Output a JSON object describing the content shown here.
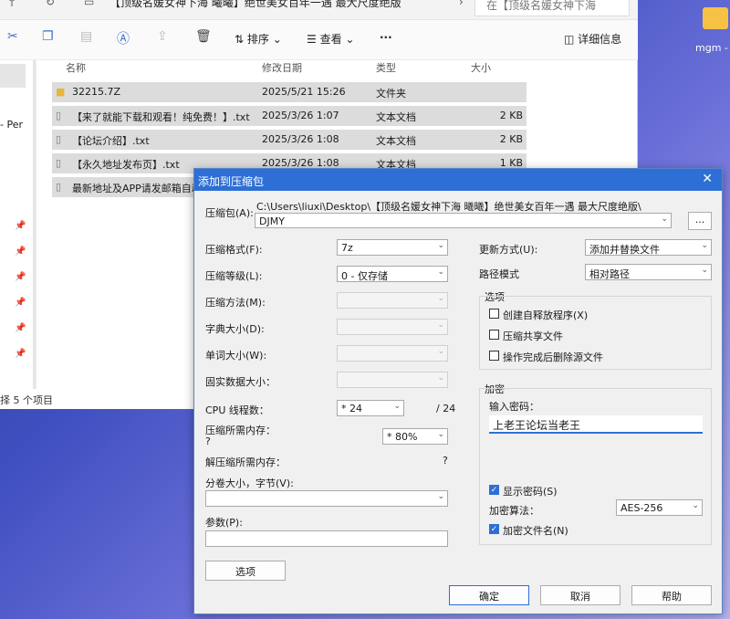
{
  "explorer": {
    "title_address": "【顶级名媛女神下海 曦曦】绝世美女百年一遇 最大尺度绝版",
    "search_placeholder": "在【顶级名媛女神下海",
    "toolbar": {
      "sort": "排序",
      "view": "查看",
      "more": "···",
      "details": "详细信息"
    },
    "columns": {
      "name": "名称",
      "date": "修改日期",
      "type": "类型",
      "size": "大小"
    },
    "files": [
      {
        "name": "32215.7Z",
        "date": "2025/5/21 15:26",
        "type": "文件夹",
        "size": ""
      },
      {
        "name": "【来了就能下载和观看！纯免费！】.txt",
        "date": "2025/3/26 1:07",
        "type": "文本文档",
        "size": "2 KB"
      },
      {
        "name": "【论坛介绍】.txt",
        "date": "2025/3/26 1:08",
        "type": "文本文档",
        "size": "2 KB"
      },
      {
        "name": "【永久地址发布页】.txt",
        "date": "2025/3/26 1:08",
        "type": "文本文档",
        "size": "1 KB"
      },
      {
        "name": "最新地址及APP请发邮箱自动",
        "date": "",
        "type": "",
        "size": ""
      }
    ],
    "left_fragment": "- Per",
    "status": "择 5 个项目"
  },
  "desktop": {
    "icon_label": "mgm -"
  },
  "dialog": {
    "title": "添加到压缩包",
    "archive_label": "压缩包(A):",
    "archive_path": "C:\\Users\\liuxi\\Desktop\\【顶级名媛女神下海 曦曦】绝世美女百年一遇 最大尺度绝版\\",
    "archive_name": "DJMY",
    "browse": "...",
    "format_label": "压缩格式(F):",
    "format_value": "7z",
    "level_label": "压缩等级(L):",
    "level_value": "0 - 仅存储",
    "method_label": "压缩方法(M):",
    "dict_label": "字典大小(D):",
    "word_label": "单词大小(W):",
    "solid_label": "固实数据大小：",
    "threads_label": "CPU 线程数：",
    "threads_value": "* 24",
    "threads_total": "/ 24",
    "mem_comp_label": "压缩所需内存：",
    "mem_comp_q": "?",
    "mem_pct": "* 80%",
    "mem_decomp_label": "解压缩所需内存：",
    "mem_decomp_q": "?",
    "volume_label": "分卷大小，字节(V):",
    "params_label": "参数(P):",
    "options_btn": "选项",
    "update_label": "更新方式(U):",
    "update_value": "添加并替换文件",
    "path_label": "路径模式",
    "path_value": "相对路径",
    "options_group": "选项",
    "opt_sfx": "创建自释放程序(X)",
    "opt_shared": "压缩共享文件",
    "opt_delete": "操作完成后删除源文件",
    "encrypt_group": "加密",
    "password_label": "输入密码：",
    "password_value": "上老王论坛当老王",
    "show_pw": "显示密码(S)",
    "enc_method_label": "加密算法：",
    "enc_method_value": "AES-256",
    "enc_names": "加密文件名(N)",
    "ok": "确定",
    "cancel": "取消",
    "help": "帮助"
  }
}
